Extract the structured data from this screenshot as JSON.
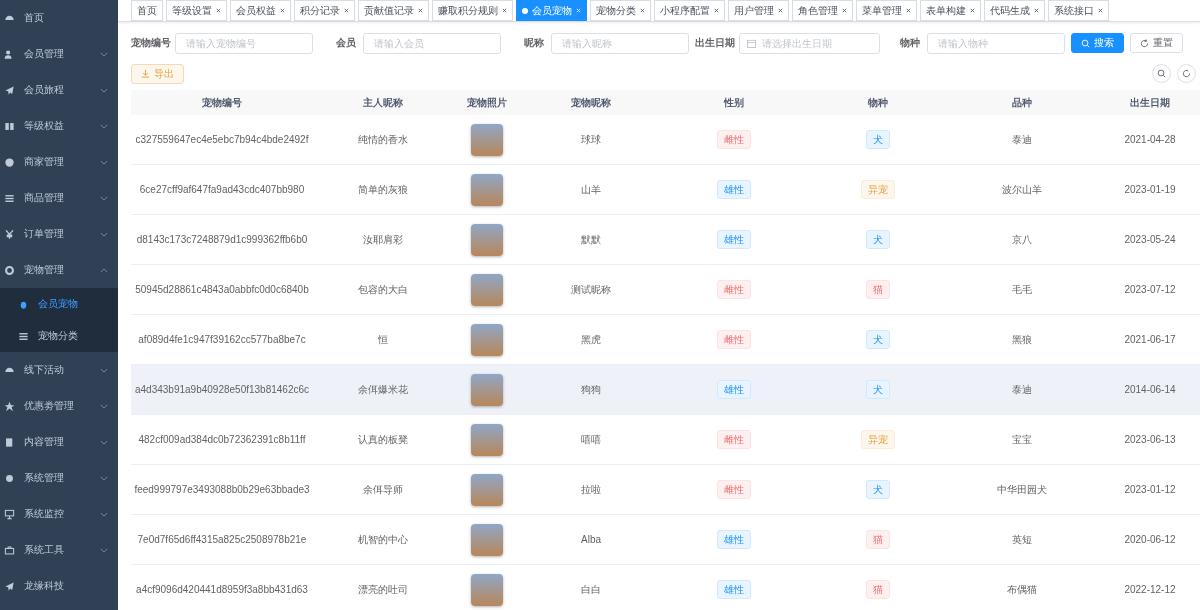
{
  "sidebar": {
    "items": [
      {
        "label": "首页",
        "kind": "link"
      },
      {
        "label": "会员管理",
        "kind": "group",
        "expanded": false
      },
      {
        "label": "会员旅程",
        "kind": "group",
        "expanded": false
      },
      {
        "label": "等级权益",
        "kind": "group",
        "expanded": false
      },
      {
        "label": "商家管理",
        "kind": "group",
        "expanded": false
      },
      {
        "label": "商品管理",
        "kind": "group",
        "expanded": false
      },
      {
        "label": "订单管理",
        "kind": "group",
        "expanded": false
      },
      {
        "label": "宠物管理",
        "kind": "group",
        "expanded": true,
        "children": [
          {
            "label": "会员宠物",
            "selected": true
          },
          {
            "label": "宠物分类",
            "selected": false
          }
        ]
      },
      {
        "label": "线下活动",
        "kind": "group",
        "expanded": false
      },
      {
        "label": "优惠劵管理",
        "kind": "group",
        "expanded": false
      },
      {
        "label": "内容管理",
        "kind": "group",
        "expanded": false
      },
      {
        "label": "系统管理",
        "kind": "group",
        "expanded": false
      },
      {
        "label": "系统监控",
        "kind": "group",
        "expanded": false
      },
      {
        "label": "系统工具",
        "kind": "group",
        "expanded": false
      },
      {
        "label": "龙缘科技",
        "kind": "link"
      }
    ]
  },
  "tabs": [
    {
      "label": "首页",
      "selected": false,
      "closable": false
    },
    {
      "label": "等级设置",
      "selected": false,
      "closable": true
    },
    {
      "label": "会员权益",
      "selected": false,
      "closable": true
    },
    {
      "label": "积分记录",
      "selected": false,
      "closable": true
    },
    {
      "label": "贡献值记录",
      "selected": false,
      "closable": true
    },
    {
      "label": "赚取积分规则",
      "selected": false,
      "closable": true
    },
    {
      "label": "会员宠物",
      "selected": true,
      "closable": true
    },
    {
      "label": "宠物分类",
      "selected": false,
      "closable": true
    },
    {
      "label": "小程序配置",
      "selected": false,
      "closable": true
    },
    {
      "label": "用户管理",
      "selected": false,
      "closable": true
    },
    {
      "label": "角色管理",
      "selected": false,
      "closable": true
    },
    {
      "label": "菜单管理",
      "selected": false,
      "closable": true
    },
    {
      "label": "表单构建",
      "selected": false,
      "closable": true
    },
    {
      "label": "代码生成",
      "selected": false,
      "closable": true
    },
    {
      "label": "系统接口",
      "selected": false,
      "closable": true
    }
  ],
  "search": {
    "fields": [
      {
        "label": "宠物编号",
        "placeholder": "请输入宠物编号",
        "kind": "text"
      },
      {
        "label": "会员",
        "placeholder": "请输入会员",
        "kind": "text"
      },
      {
        "label": "昵称",
        "placeholder": "请输入昵称",
        "kind": "text"
      },
      {
        "label": "出生日期",
        "placeholder": "请选择出生日期",
        "kind": "date"
      },
      {
        "label": "物种",
        "placeholder": "请输入物种",
        "kind": "text"
      }
    ],
    "search_button": "搜索",
    "reset_button": "重置"
  },
  "toolbar": {
    "export_button": "导出"
  },
  "table": {
    "columns": [
      "宠物编号",
      "主人昵称",
      "宠物照片",
      "宠物昵称",
      "性别",
      "物种",
      "品种",
      "出生日期"
    ],
    "rows": [
      {
        "pet_id": "c327559647ec4e5ebc7b94c4bde2492f",
        "owner": "纯情的香水",
        "nickname": "球球",
        "gender": {
          "label": "雌性",
          "kind": "danger"
        },
        "species": {
          "label": "犬",
          "kind": "primary"
        },
        "breed": "泰迪",
        "birth_date": "2021-04-28",
        "selected": false
      },
      {
        "pet_id": "6ce27cff9af647fa9ad43cdc407bb980",
        "owner": "简单的灰狼",
        "nickname": "山羊",
        "gender": {
          "label": "雄性",
          "kind": "primary"
        },
        "species": {
          "label": "异宠",
          "kind": "warning"
        },
        "breed": "波尔山羊",
        "birth_date": "2023-01-19",
        "selected": false
      },
      {
        "pet_id": "d8143c173c7248879d1c999362ffb6b0",
        "owner": "汝耶肩彩",
        "nickname": "默默",
        "gender": {
          "label": "雄性",
          "kind": "primary"
        },
        "species": {
          "label": "犬",
          "kind": "primary"
        },
        "breed": "京八",
        "birth_date": "2023-05-24",
        "selected": false
      },
      {
        "pet_id": "50945d28861c4843a0abbfc0d0c6840b",
        "owner": "包容的大白",
        "nickname": "测试昵称",
        "gender": {
          "label": "雌性",
          "kind": "danger"
        },
        "species": {
          "label": "猫",
          "kind": "danger"
        },
        "breed": "毛毛",
        "birth_date": "2023-07-12",
        "selected": false
      },
      {
        "pet_id": "af089d4fe1c947f39162cc577ba8be7c",
        "owner": "恒",
        "nickname": "黑虎",
        "gender": {
          "label": "雌性",
          "kind": "danger"
        },
        "species": {
          "label": "犬",
          "kind": "primary"
        },
        "breed": "黑狼",
        "birth_date": "2021-06-17",
        "selected": false
      },
      {
        "pet_id": "a4d343b91a9b40928e50f13b81462c6c",
        "owner": "余佴爆米花",
        "nickname": "狗狗",
        "gender": {
          "label": "雄性",
          "kind": "primary"
        },
        "species": {
          "label": "犬",
          "kind": "primary"
        },
        "breed": "泰迪",
        "birth_date": "2014-06-14",
        "selected": true
      },
      {
        "pet_id": "482cf009ad384dc0b72362391c8b11ff",
        "owner": "认真的板凳",
        "nickname": "嘻嘻",
        "gender": {
          "label": "雌性",
          "kind": "danger"
        },
        "species": {
          "label": "异宠",
          "kind": "warning"
        },
        "breed": "宝宝",
        "birth_date": "2023-06-13",
        "selected": false
      },
      {
        "pet_id": "feed999797e3493088b0b29e63bbade3",
        "owner": "余佴导师",
        "nickname": "拉啦",
        "gender": {
          "label": "雌性",
          "kind": "danger"
        },
        "species": {
          "label": "犬",
          "kind": "primary"
        },
        "breed": "中华田园犬",
        "birth_date": "2023-01-12",
        "selected": false
      },
      {
        "pet_id": "7e0d7f65d6ff4315a825c2508978b21e",
        "owner": "机智的中心",
        "nickname": "Alba",
        "gender": {
          "label": "雄性",
          "kind": "primary"
        },
        "species": {
          "label": "猫",
          "kind": "danger"
        },
        "breed": "英短",
        "birth_date": "2020-06-12",
        "selected": false
      },
      {
        "pet_id": "a4cf9096d420441d8959f3a8bb431d63",
        "owner": "漂亮的吐司",
        "nickname": "白白",
        "gender": {
          "label": "雄性",
          "kind": "primary"
        },
        "species": {
          "label": "猫",
          "kind": "danger"
        },
        "breed": "布偶猫",
        "birth_date": "2022-12-12",
        "selected": false
      }
    ]
  }
}
